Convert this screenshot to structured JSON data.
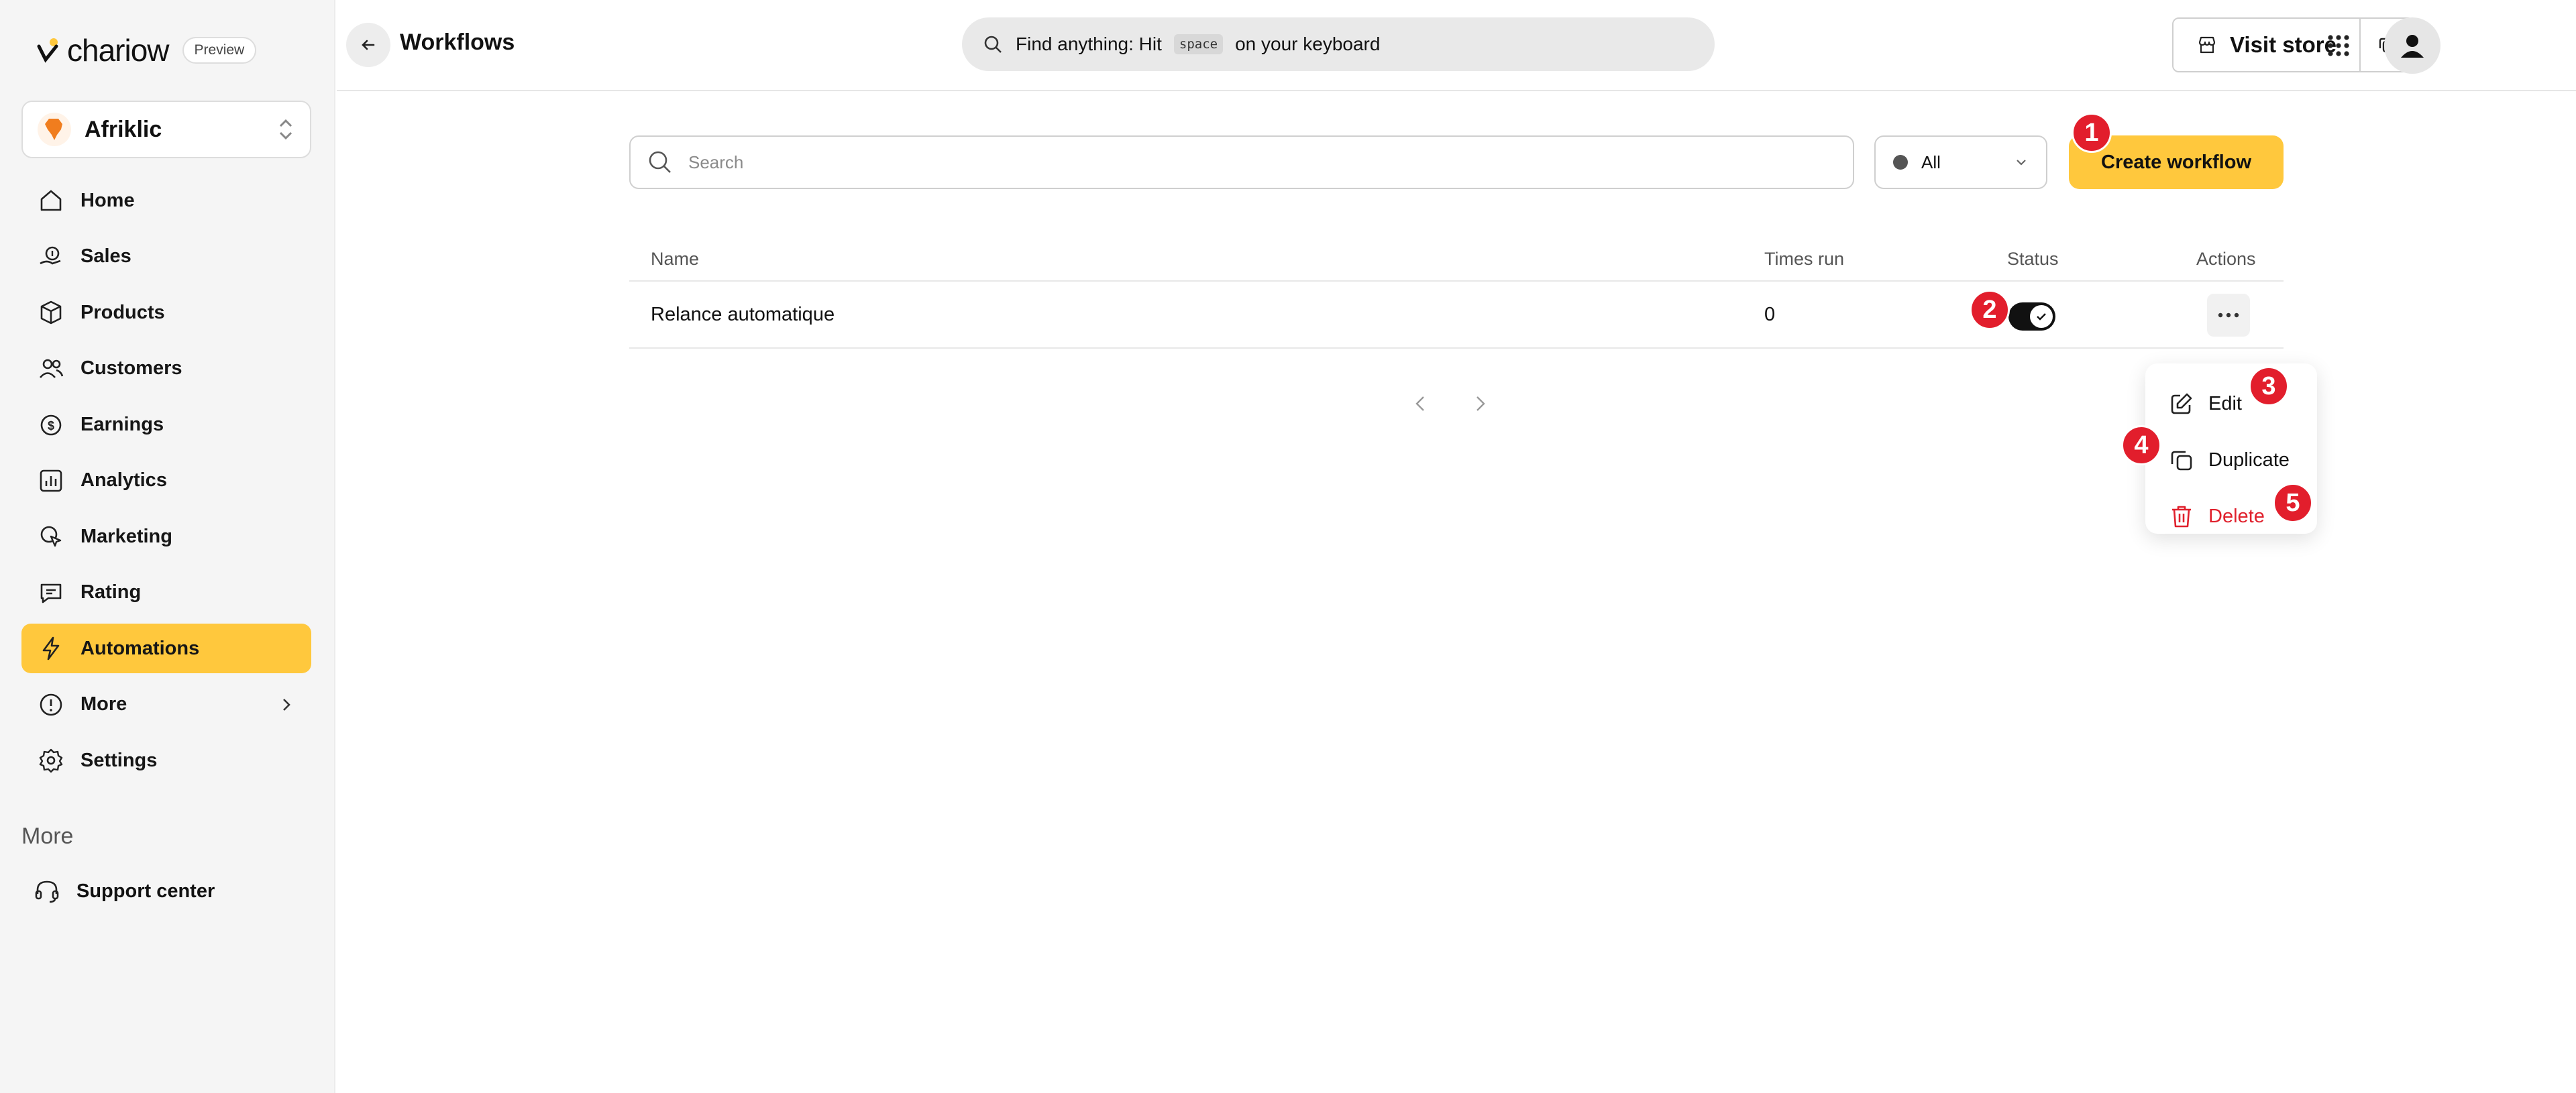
{
  "brand": {
    "name": "chariow",
    "badge": "Preview"
  },
  "store": {
    "name": "Afriklic"
  },
  "sidebar": {
    "items": [
      {
        "label": "Home",
        "icon": "home-icon"
      },
      {
        "label": "Sales",
        "icon": "sales-icon"
      },
      {
        "label": "Products",
        "icon": "box-icon"
      },
      {
        "label": "Customers",
        "icon": "users-icon"
      },
      {
        "label": "Earnings",
        "icon": "earnings-icon"
      },
      {
        "label": "Analytics",
        "icon": "analytics-icon"
      },
      {
        "label": "Marketing",
        "icon": "marketing-icon"
      },
      {
        "label": "Rating",
        "icon": "rating-icon"
      },
      {
        "label": "Automations",
        "icon": "bolt-icon",
        "active": true
      },
      {
        "label": "More",
        "icon": "info-icon"
      },
      {
        "label": "Settings",
        "icon": "gear-icon"
      }
    ],
    "more_heading": "More",
    "support_label": "Support center"
  },
  "header": {
    "title": "Workflows",
    "search_prefix": "Find anything: Hit",
    "search_key": "space",
    "search_suffix": "on your keyboard",
    "visit_store": "Visit store"
  },
  "toolbar": {
    "search_placeholder": "Search",
    "status_filter": "All",
    "create_label": "Create workflow"
  },
  "table": {
    "columns": [
      "Name",
      "Times run",
      "Status",
      "Actions"
    ],
    "rows": [
      {
        "name": "Relance automatique",
        "times_run": "0",
        "status_on": true
      }
    ]
  },
  "menu": {
    "edit": "Edit",
    "duplicate": "Duplicate",
    "delete": "Delete"
  },
  "annotations": [
    "1",
    "2",
    "3",
    "4",
    "5"
  ],
  "colors": {
    "accent": "#ffc83d",
    "danger": "#e0202c",
    "badge": "#e21e2c"
  }
}
